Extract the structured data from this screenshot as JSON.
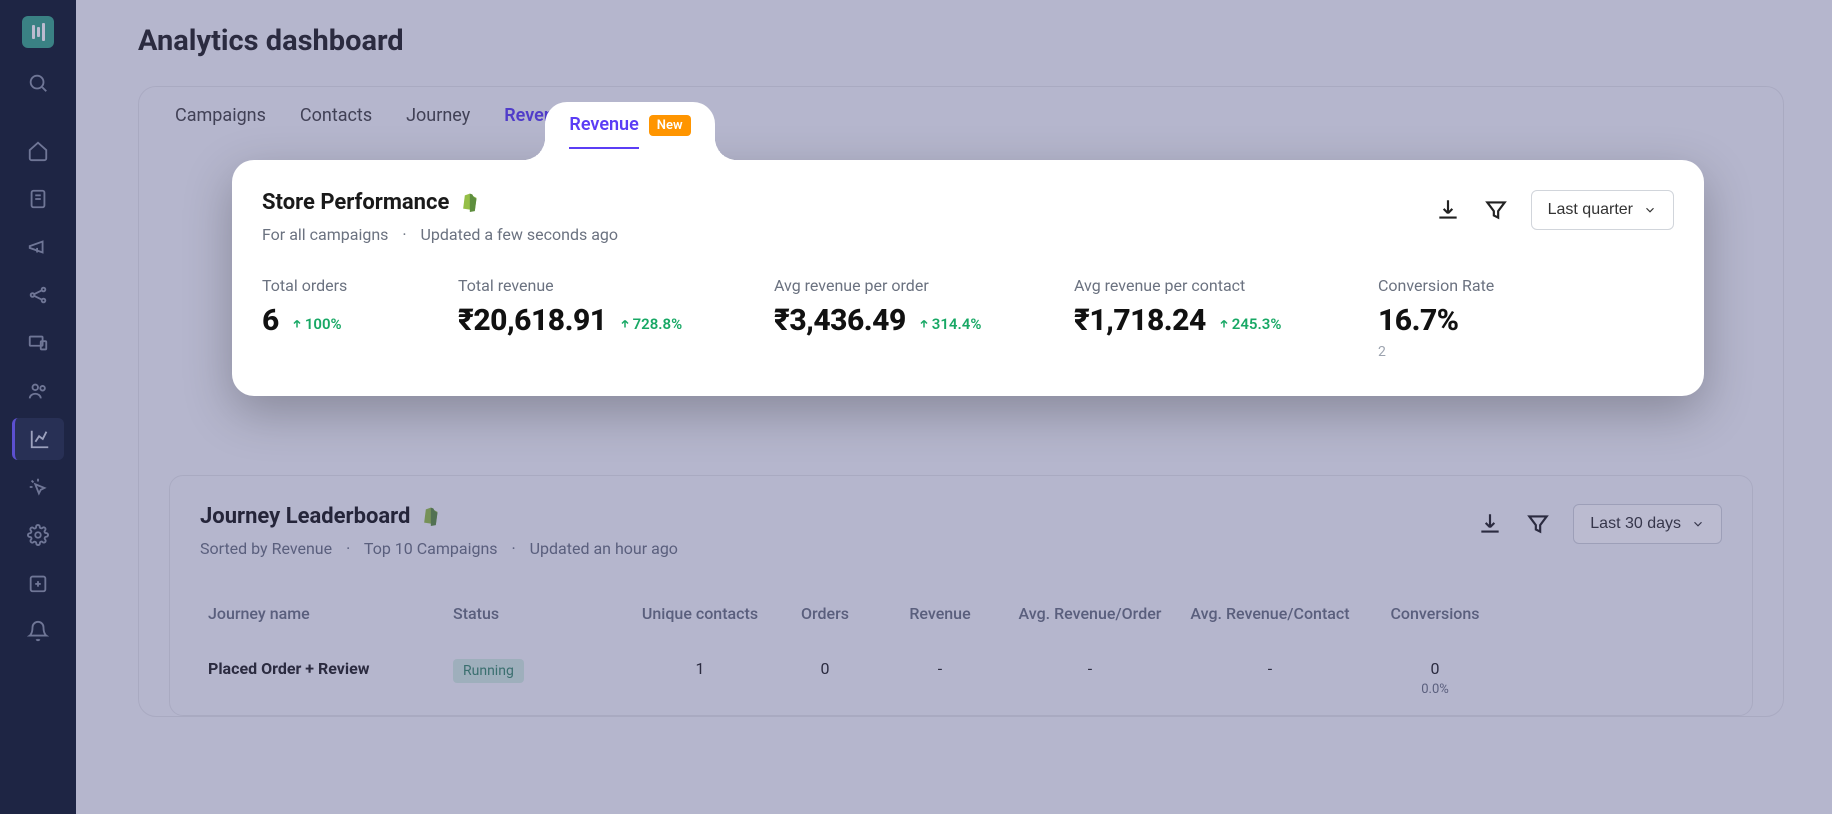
{
  "page": {
    "title": "Analytics dashboard"
  },
  "tabs": {
    "items": [
      {
        "label": "Campaigns"
      },
      {
        "label": "Contacts"
      },
      {
        "label": "Journey"
      },
      {
        "label": "Revenue",
        "badge": "New"
      }
    ],
    "activeIndex": 3
  },
  "store": {
    "title": "Store Performance",
    "sub_scope": "For all campaigns",
    "sub_updated": "Updated a few seconds ago",
    "range_label": "Last quarter",
    "stats": [
      {
        "label": "Total orders",
        "value": "6",
        "delta": "100%"
      },
      {
        "label": "Total revenue",
        "value": "₹20,618.91",
        "delta": "728.8%"
      },
      {
        "label": "Avg revenue per order",
        "value": "₹3,436.49",
        "delta": "314.4%"
      },
      {
        "label": "Avg revenue per contact",
        "value": "₹1,718.24",
        "delta": "245.3%"
      },
      {
        "label": "Conversion Rate",
        "value": "16.7%",
        "delta": "",
        "note": "2"
      }
    ]
  },
  "leaderboard": {
    "title": "Journey Leaderboard",
    "sub_sorted": "Sorted by Revenue",
    "sub_top": "Top 10 Campaigns",
    "sub_updated": "Updated an hour ago",
    "range_label": "Last 30 days",
    "columns": {
      "name": "Journey name",
      "status": "Status",
      "unique_contacts": "Unique contacts",
      "orders": "Orders",
      "revenue": "Revenue",
      "avg_rev_order": "Avg. Revenue/Order",
      "avg_rev_contact": "Avg. Revenue/Contact",
      "conversions": "Conversions"
    },
    "rows": [
      {
        "name": "Placed Order + Review",
        "status": "Running",
        "unique_contacts": "1",
        "orders": "0",
        "revenue": "-",
        "avg_rev_order": "-",
        "avg_rev_contact": "-",
        "conversions": "0",
        "conversions_pct": "0.0%"
      }
    ]
  }
}
